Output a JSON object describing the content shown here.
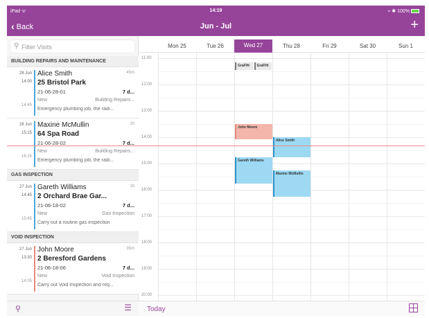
{
  "status": {
    "left": "iPad ᯤ",
    "time": "14:19",
    "right": "⌁ ✱ 100%"
  },
  "nav": {
    "back_label": "Back",
    "title": "Jun - Jul",
    "add_label": "+"
  },
  "search": {
    "placeholder": "Filter Visits"
  },
  "sections": [
    {
      "title": "BUILDING REPAIRS AND MAINTENANCE",
      "items": [
        {
          "date": "28 Jun",
          "start": "14:00",
          "end": "14:45",
          "duration": "45m",
          "name": "Alice Smith",
          "address": "25 Bristol Park",
          "ref": "21-06-28-01",
          "days": "7 d...",
          "status": "New",
          "type": "Building Repairs...",
          "description": "Emergency plumbing job, the radi...",
          "color": "#4aa6d8"
        },
        {
          "date": "28 Jun",
          "start": "15:15",
          "end": "16:15",
          "duration": "1h",
          "name": "Maxine McMullin",
          "address": "64 Spa Road",
          "ref": "21-06-28-02",
          "days": "7 d...",
          "status": "New",
          "type": "Building Repairs...",
          "description": "Emergency plumbing job, the radi...",
          "color": "#4aa6d8"
        }
      ]
    },
    {
      "title": "GAS INSPECTION",
      "items": [
        {
          "date": "27 Jun",
          "start": "14:45",
          "end": "15:45",
          "duration": "1h",
          "name": "Gareth Williams",
          "address": "2 Orchard Brae Gar...",
          "ref": "21-06-18-02",
          "days": "7 d...",
          "status": "New",
          "type": "Gas Inspection",
          "description": "Carry out a routine gas inspection",
          "color": "#4aa6d8"
        }
      ]
    },
    {
      "title": "VOID INSPECTION",
      "items": [
        {
          "date": "27 Jun",
          "start": "13:30",
          "end": "14:05",
          "duration": "35m",
          "name": "John Moore",
          "address": "2 Beresford Gardens",
          "ref": "21-06-18-06",
          "days": "7 d...",
          "status": "New",
          "type": "Void Inspection",
          "description": "Carry out Void Inspection and req...",
          "color": "#e8897c"
        }
      ]
    }
  ],
  "calendar": {
    "days": [
      "Mon 25",
      "Tue 26",
      "Wed 27",
      "Thu 28",
      "Fri 29",
      "Sat 30",
      "Sun 1"
    ],
    "selected_day": "Wed 27",
    "hours": [
      "11:00",
      "12:00",
      "13:00",
      "14:00",
      "15:00",
      "16:00",
      "17:00",
      "18:00",
      "19:00",
      "20:00"
    ],
    "now_time": "14:19",
    "events": [
      {
        "title": "GraFHt",
        "day": 2,
        "start": 11.15,
        "end": 11.45,
        "bg": "#e9e9e9",
        "edge": "#777777"
      },
      {
        "title": "GraFHt",
        "day": 2.5,
        "start": 11.15,
        "end": 11.45,
        "bg": "#e9e9e9",
        "edge": "#777777"
      },
      {
        "title": "John Moore",
        "day": 2,
        "start": 13.5,
        "end": 14.08,
        "bg": "#f4b6aa",
        "edge": "#e8897c"
      },
      {
        "title": "Alice Smith",
        "day": 3,
        "start": 14.0,
        "end": 14.75,
        "bg": "#9dd9f3",
        "edge": "#2e93c9"
      },
      {
        "title": "Gareth Williams",
        "day": 2,
        "start": 14.75,
        "end": 15.75,
        "bg": "#9dd9f3",
        "edge": "#2e93c9"
      },
      {
        "title": "Maxine McMullin",
        "day": 3,
        "start": 15.25,
        "end": 16.25,
        "bg": "#9dd9f3",
        "edge": "#2e93c9"
      }
    ],
    "today_label": "Today"
  },
  "colors": {
    "brand": "#96449a",
    "now_line": "#e88b86"
  }
}
